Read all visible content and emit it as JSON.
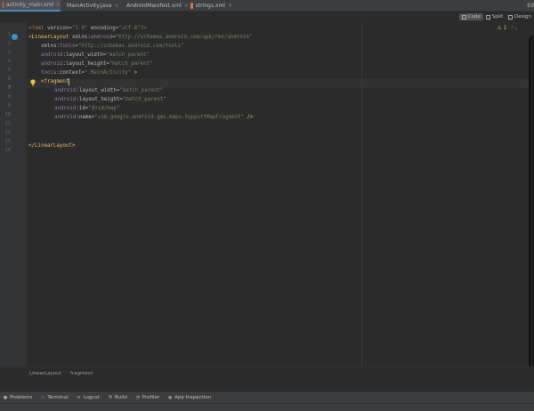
{
  "tabs": [
    {
      "label": "activity_main.xml",
      "icon": "xml-file-icon",
      "color": "#e37933",
      "active": true
    },
    {
      "label": "MainActivity.java",
      "icon": "java-class-icon",
      "color": "#3592c4",
      "active": false
    },
    {
      "label": "AndroidManifest.xml",
      "icon": "android-manifest-icon",
      "color": "#6a8759",
      "active": false
    },
    {
      "label": "strings.xml",
      "icon": "xml-file-icon",
      "color": "#e37933",
      "active": false
    }
  ],
  "overflow": "Ed",
  "view_modes": {
    "code": "Code",
    "split": "Split",
    "design": "Design"
  },
  "warnings": {
    "count": "1"
  },
  "line_numbers": [
    "1",
    "2",
    "3",
    "4",
    "5",
    "6",
    "7",
    "8",
    "9",
    "10",
    "11",
    "12",
    "13",
    "14"
  ],
  "code": {
    "l1": {
      "a": "<?xml ",
      "b": "version",
      "c": "=",
      "d": "\"1.0\"",
      "e": " encoding",
      "f": "=",
      "g": "\"utf-8\"",
      "h": "?>"
    },
    "l2": {
      "a": "<LinearLayout ",
      "b": "xmlns:",
      "c": "android",
      "d": "=",
      "e": "\"http://schemas.android.com/apk/res/android\""
    },
    "l3": {
      "a": "xmlns:",
      "b": "tools",
      "c": "=",
      "d": "\"http://schemas.android.com/tools\""
    },
    "l4": {
      "a": "android",
      "b": ":layout_width",
      "c": "=",
      "d": "\"match_parent\""
    },
    "l5": {
      "a": "android",
      "b": ":layout_height",
      "c": "=",
      "d": "\"match_parent\""
    },
    "l6": {
      "a": "tools",
      "b": ":context",
      "c": "=",
      "d": "\".MainActivity\"",
      "e": " >"
    },
    "l7": {
      "a": "<fragment"
    },
    "l8": {
      "a": "android",
      "b": ":layout_width",
      "c": "=",
      "d": "\"match_parent\""
    },
    "l9": {
      "a": "android",
      "b": ":layout_height",
      "c": "=",
      "d": "\"match_parent\""
    },
    "l10": {
      "a": "android",
      "b": ":id",
      "c": "=",
      "d": "\"@+id/map\""
    },
    "l11": {
      "a": "android",
      "b": ":name",
      "c": "=",
      "d": "\"com.google.android.gms.maps.SupportMapFragment\"",
      "e": " />"
    },
    "l14": {
      "a": "</LinearLayout>"
    }
  },
  "breadcrumb": [
    "LinearLayout",
    "fragment"
  ],
  "bottom_tools": [
    {
      "label": "Problems",
      "icon": "problems-icon"
    },
    {
      "label": "Terminal",
      "icon": "terminal-icon"
    },
    {
      "label": "Logcat",
      "icon": "logcat-icon"
    },
    {
      "label": "Build",
      "icon": "build-icon"
    },
    {
      "label": "Profiler",
      "icon": "profiler-icon"
    },
    {
      "label": "App Inspection",
      "icon": "app-inspection-icon"
    }
  ]
}
